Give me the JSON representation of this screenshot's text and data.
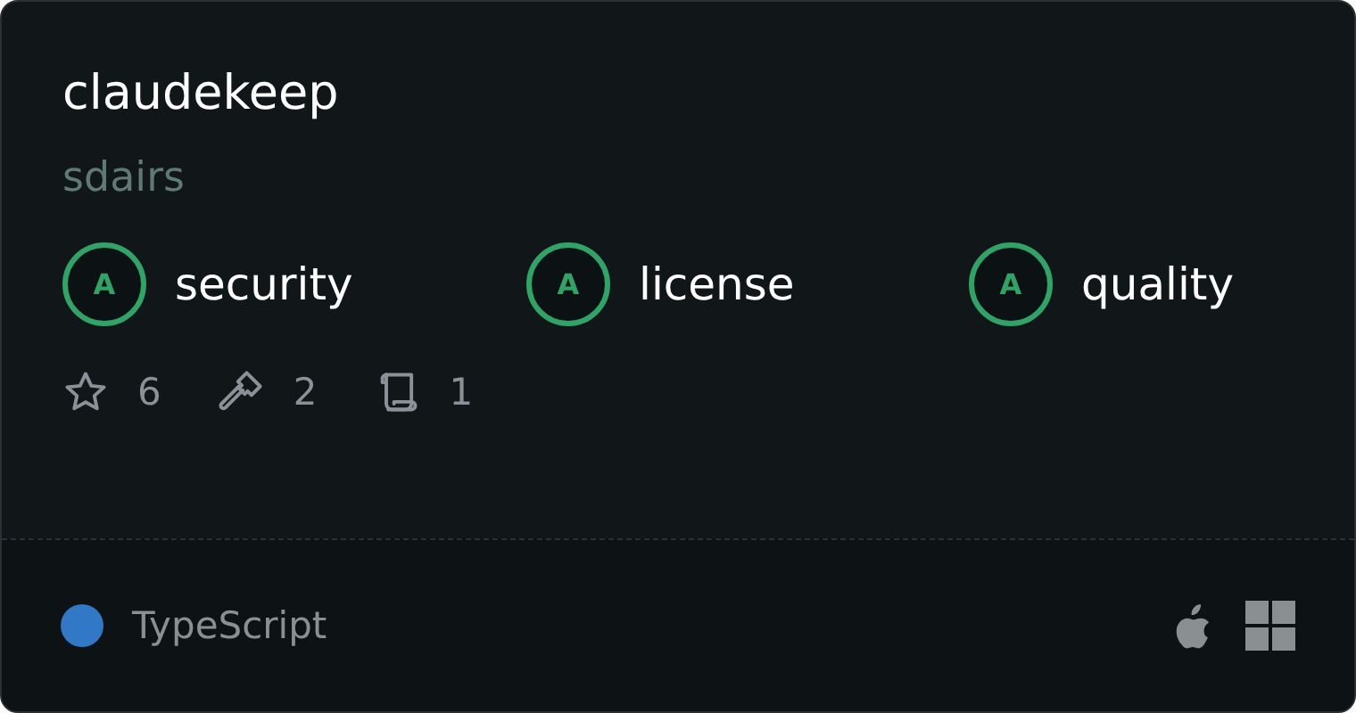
{
  "repo": {
    "name": "claudekeep",
    "owner": "sdairs"
  },
  "scores": [
    {
      "grade": "A",
      "label": "security"
    },
    {
      "grade": "A",
      "label": "license"
    },
    {
      "grade": "A",
      "label": "quality"
    }
  ],
  "stats": [
    {
      "kind": "stars",
      "value": "6"
    },
    {
      "kind": "tools",
      "value": "2"
    },
    {
      "kind": "scroll",
      "value": "1"
    }
  ],
  "language": {
    "name": "TypeScript",
    "color": "#3178c6"
  },
  "platforms": [
    {
      "kind": "apple"
    },
    {
      "kind": "windows"
    }
  ]
}
